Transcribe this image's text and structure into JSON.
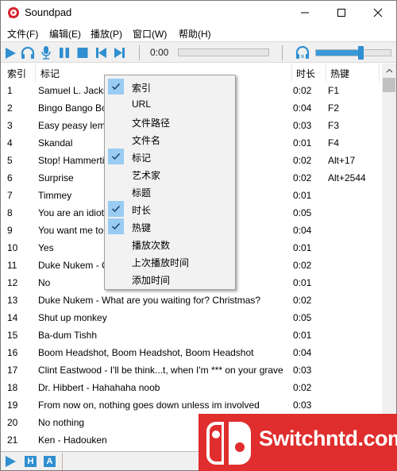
{
  "window": {
    "title": "Soundpad",
    "controls": {
      "minimize": "—",
      "maximize": "☐",
      "close": "✕"
    }
  },
  "menubar": {
    "items": [
      {
        "label": "文件(F)"
      },
      {
        "label": "编辑(E)"
      },
      {
        "label": "播放(P)"
      },
      {
        "label": "窗口(W)"
      },
      {
        "label": "帮助(H)"
      }
    ]
  },
  "toolbar": {
    "buttons": [
      "play-icon",
      "headphones-icon",
      "microphone-icon",
      "pause-icon",
      "stop-icon",
      "previous-icon",
      "next-icon"
    ],
    "time": "0:00",
    "progress": 0,
    "volume": 0.6,
    "accent_color": "#2f8fd0"
  },
  "table": {
    "columns": [
      "索引",
      "标记",
      "时长",
      "热键"
    ],
    "rows": [
      {
        "index": "1",
        "tag": "Samuel L. Jackson",
        "duration": "0:02",
        "hotkey": "F1"
      },
      {
        "index": "2",
        "tag": "Bingo Bango Bongo",
        "duration": "0:04",
        "hotkey": "F2"
      },
      {
        "index": "3",
        "tag": "Easy peasy lemon",
        "duration": "0:03",
        "hotkey": "F3"
      },
      {
        "index": "4",
        "tag": "Skandal",
        "duration": "0:01",
        "hotkey": "F4"
      },
      {
        "index": "5",
        "tag": "Stop! Hammertime",
        "duration": "0:02",
        "hotkey": "Alt+17"
      },
      {
        "index": "6",
        "tag": "Surprise",
        "duration": "0:02",
        "hotkey": "Alt+2544"
      },
      {
        "index": "7",
        "tag": "Timmey",
        "duration": "0:01",
        "hotkey": ""
      },
      {
        "index": "8",
        "tag": "You are an idiot",
        "duration": "0:05",
        "hotkey": ""
      },
      {
        "index": "9",
        "tag": "You want me to                                     ough",
        "duration": "0:04",
        "hotkey": ""
      },
      {
        "index": "10",
        "tag": "Yes",
        "duration": "0:01",
        "hotkey": ""
      },
      {
        "index": "11",
        "tag": "Duke Nukem - C",
        "duration": "0:02",
        "hotkey": ""
      },
      {
        "index": "12",
        "tag": "No",
        "duration": "0:01",
        "hotkey": ""
      },
      {
        "index": "13",
        "tag": "Duke Nukem - What are you waiting for? Christmas?",
        "duration": "0:02",
        "hotkey": ""
      },
      {
        "index": "14",
        "tag": "Shut up monkey",
        "duration": "0:05",
        "hotkey": ""
      },
      {
        "index": "15",
        "tag": "Ba-dum Tishh",
        "duration": "0:01",
        "hotkey": ""
      },
      {
        "index": "16",
        "tag": "Boom Headshot, Boom Headshot, Boom Headshot",
        "duration": "0:04",
        "hotkey": ""
      },
      {
        "index": "17",
        "tag": "Clint Eastwood - I'll be think...t, when I'm *** on your grave",
        "duration": "0:03",
        "hotkey": ""
      },
      {
        "index": "18",
        "tag": "Dr. Hibbert - Hahahaha noob",
        "duration": "0:02",
        "hotkey": ""
      },
      {
        "index": "19",
        "tag": "From now on, nothing goes down unless im involved",
        "duration": "0:03",
        "hotkey": ""
      },
      {
        "index": "20",
        "tag": "No nothing",
        "duration": "",
        "hotkey": ""
      },
      {
        "index": "21",
        "tag": "Ken - Hadouken",
        "duration": "",
        "hotkey": ""
      }
    ]
  },
  "context_menu": {
    "items": [
      {
        "label": "索引",
        "checked": true
      },
      {
        "label": "URL",
        "checked": false
      },
      {
        "label": "文件路径",
        "checked": false
      },
      {
        "label": "文件名",
        "checked": false
      },
      {
        "label": "标记",
        "checked": true
      },
      {
        "label": "艺术家",
        "checked": false
      },
      {
        "label": "标题",
        "checked": false
      },
      {
        "label": "时长",
        "checked": true
      },
      {
        "label": "热键",
        "checked": true
      },
      {
        "label": "播放次数",
        "checked": false
      },
      {
        "label": "上次播放时间",
        "checked": false
      },
      {
        "label": "添加时间",
        "checked": false
      }
    ]
  },
  "statusbar": {
    "buttons": [
      {
        "icon": "play-icon"
      },
      {
        "letter": "H"
      },
      {
        "letter": "A"
      }
    ]
  },
  "watermark": {
    "text": "Switchntd.com",
    "color": "#e02d2d"
  }
}
